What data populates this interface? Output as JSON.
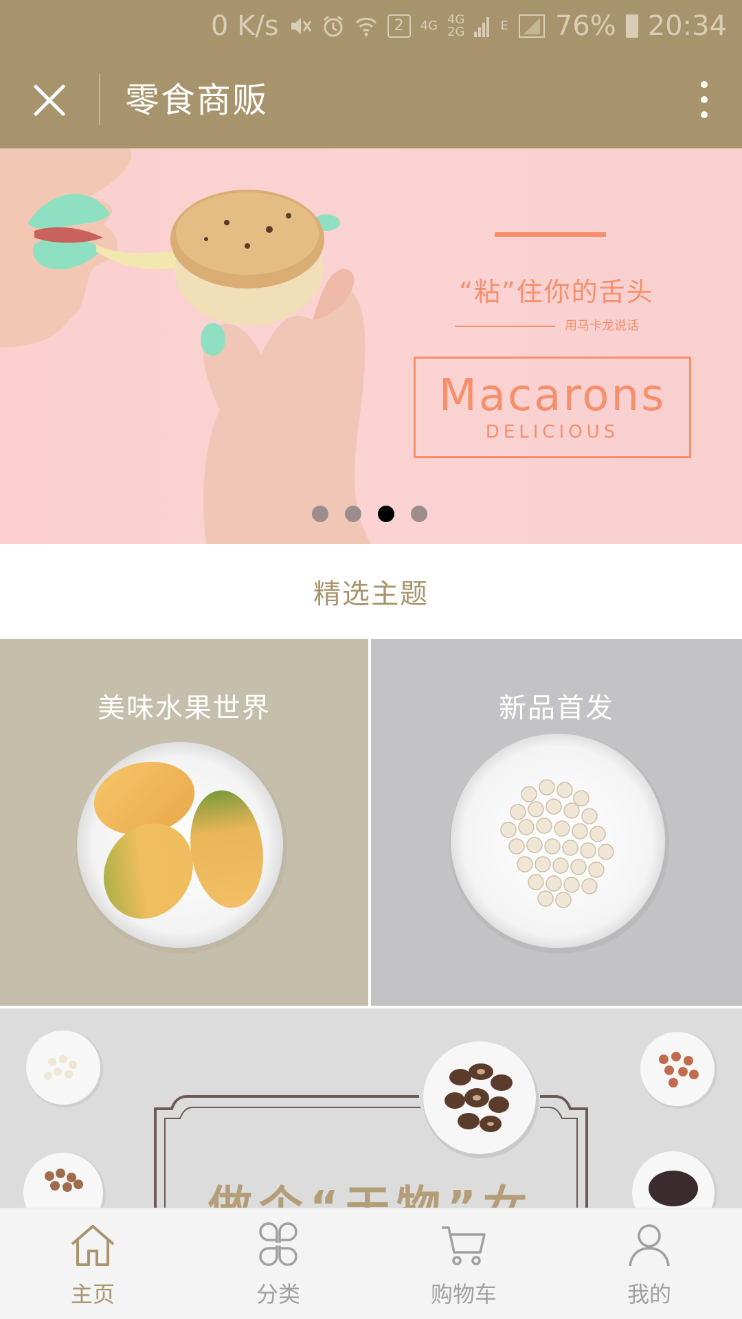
{
  "status_bar": {
    "speed": "0 K/s",
    "sim_badge": "2",
    "net_4g_a": "4G",
    "net_4g_b": "4G",
    "net_2g": "2G",
    "net_e": "E",
    "battery": "76%",
    "time": "20:34",
    "icons": [
      "mute-icon",
      "alarm-icon",
      "wifi-icon",
      "signal-icon",
      "battery-icon"
    ]
  },
  "navbar": {
    "title": "零食商贩",
    "close_icon": "close-icon",
    "more_icon": "more-vertical-icon"
  },
  "banner": {
    "slogan": "“粘”住你的舌头",
    "subtext": "用马卡龙说话",
    "box_title": "Macarons",
    "box_subtitle": "DELICIOUS",
    "slide_count": 4,
    "active_slide": 3,
    "accent_color": "#f58f6c"
  },
  "section": {
    "title": "精选主题"
  },
  "themes": [
    {
      "label": "美味水果世界"
    },
    {
      "label": "新品首发"
    }
  ],
  "promo": {
    "title": "做个“干物”女"
  },
  "tabbar": {
    "items": [
      {
        "label": "主页",
        "icon": "home-icon",
        "active": true
      },
      {
        "label": "分类",
        "icon": "category-icon",
        "active": false
      },
      {
        "label": "购物车",
        "icon": "cart-icon",
        "active": false
      },
      {
        "label": "我的",
        "icon": "profile-icon",
        "active": false
      }
    ]
  },
  "colors": {
    "brand": "#a8946c",
    "tab_inactive": "#a0a0a0"
  }
}
